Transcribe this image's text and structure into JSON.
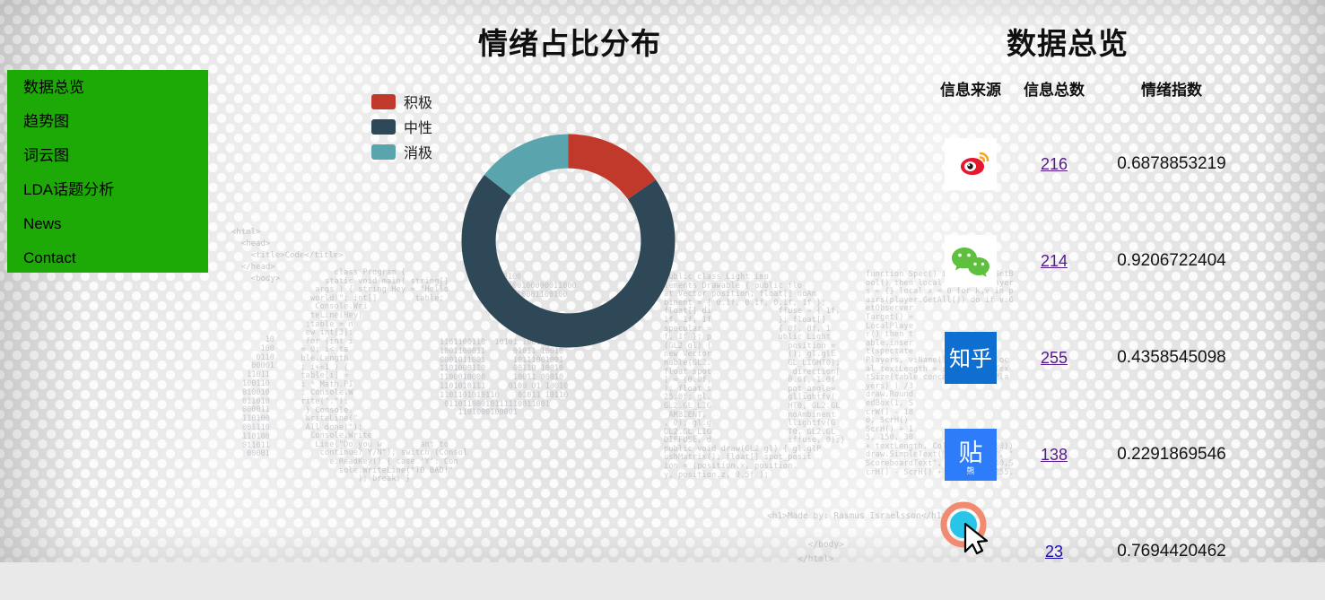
{
  "titles": {
    "chart": "情绪占比分布",
    "table": "数据总览"
  },
  "sidebar": {
    "items": [
      {
        "label": "数据总览",
        "name": "sidebar-item-overview"
      },
      {
        "label": "趋势图",
        "name": "sidebar-item-trend"
      },
      {
        "label": "词云图",
        "name": "sidebar-item-wordcloud"
      },
      {
        "label": "LDA话题分析",
        "name": "sidebar-item-lda"
      },
      {
        "label": "News",
        "name": "sidebar-item-news"
      },
      {
        "label": "Contact",
        "name": "sidebar-item-contact"
      }
    ],
    "background_color": "#1eaa06"
  },
  "legend": {
    "items": [
      {
        "label": "积极",
        "color": "#c0392b"
      },
      {
        "label": "中性",
        "color": "#2f4858"
      },
      {
        "label": "消极",
        "color": "#5aa5ad"
      }
    ]
  },
  "chart_data": {
    "type": "pie",
    "title": "情绪占比分布",
    "variant": "donut",
    "legend_position": "left",
    "labels": [
      "积极",
      "中性",
      "消极"
    ],
    "values": [
      15.3,
      70.3,
      14.4
    ],
    "unit": "%",
    "colors": [
      "#c0392b",
      "#2f4858",
      "#5aa5ad"
    ],
    "start_angle_deg": 0,
    "direction": "clockwise",
    "inner_radius_ratio": 0.68
  },
  "table": {
    "headers": {
      "source": "信息来源",
      "count": "信息总数",
      "sentiment": "情绪指数"
    },
    "rows": [
      {
        "source_icon": "weibo-icon",
        "source_name": "微博",
        "count": "216",
        "count_state": "visited",
        "sentiment": "0.6878853219"
      },
      {
        "source_icon": "wechat-icon",
        "source_name": "微信",
        "count": "214",
        "count_state": "visited",
        "sentiment": "0.9206722404"
      },
      {
        "source_icon": "zhihu-icon",
        "source_name": "知乎",
        "count": "255",
        "count_state": "visited",
        "sentiment": "0.4358545098"
      },
      {
        "source_icon": "tieba-icon",
        "source_name": "贴吧",
        "count": "138",
        "count_state": "visited",
        "sentiment": "0.2291869546"
      },
      {
        "source_icon": "other-icon",
        "source_name": "",
        "count": "23",
        "count_state": "fresh",
        "sentiment": "0.7694420462"
      }
    ]
  },
  "icon_labels": {
    "zhihu": "知乎",
    "tieba": "贴"
  },
  "background": {
    "code_html": "<html>\n  <head>\n    <title>Code</title>\n  </head>\n    <body>",
    "code_footer": "<h1>Made by: Rasmus Israelsson</h1>\n\n        </body>\n      </html>",
    "code_c": "        class Program {\n      static void main( string[]\n    args ) { string Hey = \"Hello\n   world!\"; int[]        table;\n    Console.Wri\n   teLine(Hey)\n  ;table = n\n  ew int[3];\n  for (int i\n = 0; i< ta\n ble.Length\n ; i+=1 ) {\n table[i] =\n i * Math.PI\n ; Console.W\n rite(\".\");\n  } Console.\n  WriteLine(\"\n  All done!\");\n   Console.Write\n    Line(\"Do you w        ant to\n     continue? Y/N\"); switch (Consol\n       e.ReadKey() { case 'Y': Con\n         sole.WriteLine(\"TO BAD!\"\n             ); break; }",
    "code_light": "public class Light imp\nlements Drawable { public flo\nat Vector position; float[] noAm\nbinent = { 0.1f, 0.1f, 0.1f, 1f };\nfloat[] di              ffuse = { 1f,\n1f, 1f, 1f              }; float[]\nspecular =              { 0f, 0f, 1\nf, 1f }; p              ublic Light\n(GL2 gl) {                position =\nnew Vector                (); gl.glE\nnable(GL2.                GL_LIGHT0);\nfloat spot                _direction[\n] = (0.0f,                0.0f,-1.0f\n); float s                pot_angle=\n25.0f; gl.                gllightfv(\nGL2.GL_LIG                HT0, GL2.GL\n_AMBIENT,                 noAmbinent\n, 0); gl.g                llightfv(G\nGL2.GL_LIG                T0, GL2.GL_\nDIFFUSE, d                iffuse, 0);}\npublic void draw(GL2 gl) { gl.glP\nushMatrix(); float[] spot_posit\nion = (position.x, position.\ny, position.z, 0.5f );",
    "code_lua": "function Spec() if ErfSpec:GetB\nool() then local spectatePlayer\ns = {} local x = 0 for k,v in p\nairs(player.GetAll()) do if v:G\netObserver\nTarget() =\nLocalPlaye\nr() then t\nable.inser\nt(spectate\nPlayers, v:Name()) end end loc\nal textLength = surface.GetTex\ntSize(table.concat(spectatePla\nyers) ) /3\ndraw.Round\nedBox(1, S\ncrW() - 18\n0, ScrH()-\nScrH() + 1\n5, 150, 30\n+ textLength, Color(0,0,0,150))\ndraw.SimpleText(\"Spectators\", \"\nScoreboardText\", ScrW() - 140,S\ncrH() - ScrH() + 16, Color(255,"
  }
}
